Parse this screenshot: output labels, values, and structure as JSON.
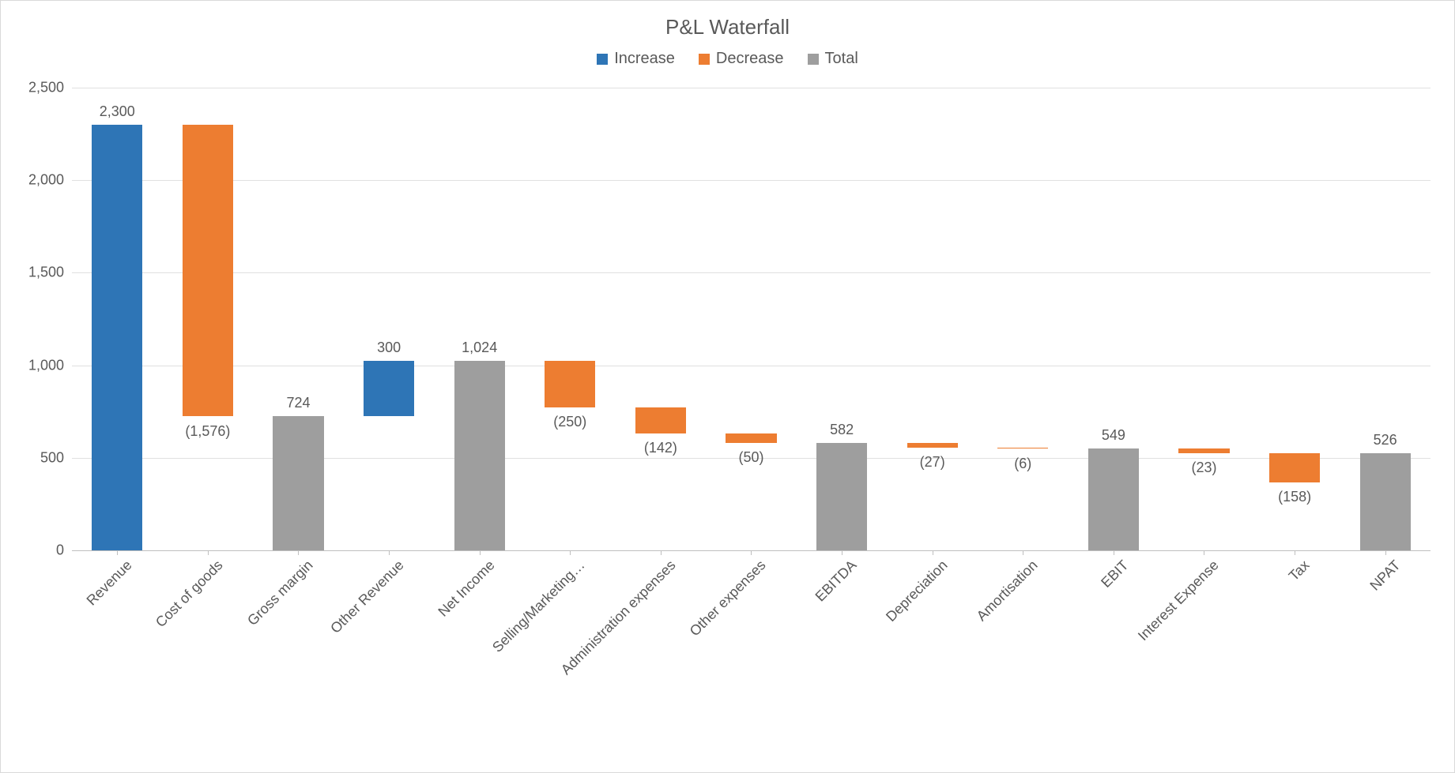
{
  "chart_data": {
    "type": "waterfall",
    "title": "P&L Waterfall",
    "ylim": [
      0,
      2500
    ],
    "ystep": 500,
    "yticks": [
      "0",
      "500",
      "1,000",
      "1,500",
      "2,000",
      "2,500"
    ],
    "legend": [
      {
        "name": "Increase",
        "color": "#2E75B6"
      },
      {
        "name": "Decrease",
        "color": "#ED7D31"
      },
      {
        "name": "Total",
        "color": "#9E9E9E"
      }
    ],
    "colors": {
      "increase": "#2E75B6",
      "decrease": "#ED7D31",
      "total": "#9E9E9E"
    },
    "items": [
      {
        "category": "Revenue",
        "label": "2,300",
        "value": 2300,
        "kind": "increase",
        "cumulative": 2300
      },
      {
        "category": "Cost of goods",
        "label": "(1,576)",
        "value": -1576,
        "kind": "decrease",
        "cumulative": 724
      },
      {
        "category": "Gross margin",
        "label": "724",
        "value": 724,
        "kind": "total",
        "cumulative": 724
      },
      {
        "category": "Other Revenue",
        "label": "300",
        "value": 300,
        "kind": "increase",
        "cumulative": 1024
      },
      {
        "category": "Net Income",
        "label": "1,024",
        "value": 1024,
        "kind": "total",
        "cumulative": 1024
      },
      {
        "category": "Selling/Marketing…",
        "label": "(250)",
        "value": -250,
        "kind": "decrease",
        "cumulative": 774
      },
      {
        "category": "Administration expenses",
        "label": "(142)",
        "value": -142,
        "kind": "decrease",
        "cumulative": 632
      },
      {
        "category": "Other expenses",
        "label": "(50)",
        "value": -50,
        "kind": "decrease",
        "cumulative": 582
      },
      {
        "category": "EBITDA",
        "label": "582",
        "value": 582,
        "kind": "total",
        "cumulative": 582
      },
      {
        "category": "Depreciation",
        "label": "(27)",
        "value": -27,
        "kind": "decrease",
        "cumulative": 555
      },
      {
        "category": "Amortisation",
        "label": "(6)",
        "value": -6,
        "kind": "decrease",
        "cumulative": 549
      },
      {
        "category": "EBIT",
        "label": "549",
        "value": 549,
        "kind": "total",
        "cumulative": 549
      },
      {
        "category": "Interest Expense",
        "label": "(23)",
        "value": -23,
        "kind": "decrease",
        "cumulative": 526
      },
      {
        "category": "Tax",
        "label": "(158)",
        "value": -158,
        "kind": "decrease",
        "cumulative": 368
      },
      {
        "category": "NPAT",
        "label": "526",
        "value": 526,
        "kind": "total",
        "cumulative": 526
      }
    ]
  }
}
